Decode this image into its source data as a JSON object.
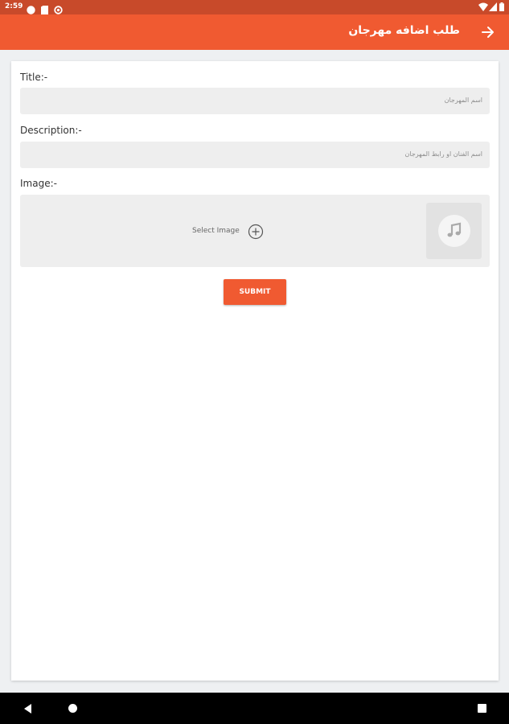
{
  "status_bar": {
    "time": "2:59",
    "left_icons": [
      "circle-icon",
      "sim-card-icon",
      "data-saver-icon"
    ],
    "right_icons": [
      "wifi-icon",
      "signal-icon",
      "battery-icon"
    ]
  },
  "app_bar": {
    "title": "طلب اضافه مهرجان",
    "back_icon": "arrow-right-icon"
  },
  "form": {
    "title_label": "Title:-",
    "title_placeholder": "اسم المهرجان",
    "description_label": "Description:-",
    "description_placeholder": "اسم الفنان او رابط المهرجان",
    "image_label": "Image:-",
    "select_image_label": "Select Image",
    "select_image_icon": "add-circle-icon",
    "thumbnail_icon": "music-note-icon",
    "submit_label": "SUBMIT"
  },
  "colors": {
    "accent": "#f05a31",
    "status_bar": "#c84a2a",
    "field_bg": "#eeeeee",
    "page_bg": "#eef0f2"
  },
  "nav_bar": {
    "icons": [
      "nav-back-icon",
      "nav-home-icon",
      "nav-recents-icon"
    ]
  }
}
